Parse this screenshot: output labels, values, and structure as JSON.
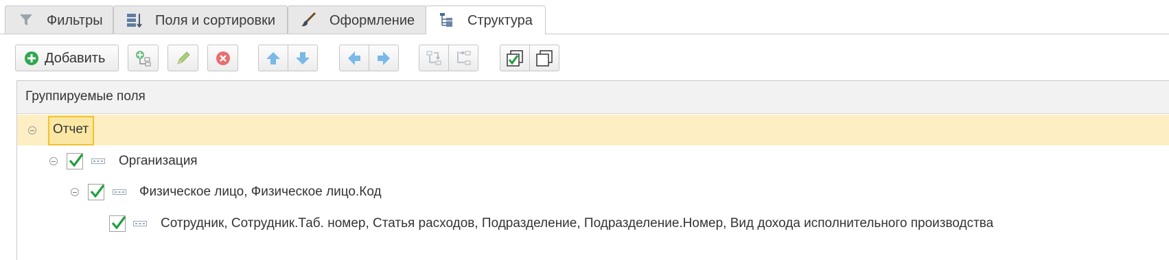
{
  "tabs": [
    {
      "label": "Фильтры",
      "icon": "funnel-icon",
      "active": false
    },
    {
      "label": "Поля и сортировки",
      "icon": "fields-sort-icon",
      "active": false
    },
    {
      "label": "Оформление",
      "icon": "brush-icon",
      "active": false
    },
    {
      "label": "Структура",
      "icon": "structure-tree-icon",
      "active": true
    }
  ],
  "toolbar": {
    "add_label": "Добавить",
    "buttons": [
      "add-grouping-icon",
      "edit-pencil-icon",
      "delete-icon",
      "move-up-icon",
      "move-down-icon",
      "move-left-icon",
      "move-right-icon",
      "group-icon",
      "ungroup-icon",
      "check-all-icon",
      "uncheck-all-icon"
    ]
  },
  "tree": {
    "header": "Группируемые поля",
    "rows": [
      {
        "label": "Отчет",
        "level": 0,
        "checked": null,
        "selected": true
      },
      {
        "label": "Организация",
        "level": 1,
        "checked": true,
        "selected": false
      },
      {
        "label": "Физическое лицо, Физическое лицо.Код",
        "level": 2,
        "checked": true,
        "selected": false
      },
      {
        "label": "Сотрудник, Сотрудник.Таб. номер, Статья расходов, Подразделение, Подразделение.Номер, Вид дохода исполнительного производства",
        "level": 3,
        "checked": true,
        "selected": false
      }
    ]
  },
  "colors": {
    "selection": "#fdefc3",
    "focus_border": "#f2c12e",
    "check_green": "#1e9e3c",
    "arrow_blue": "#5aaee6"
  }
}
